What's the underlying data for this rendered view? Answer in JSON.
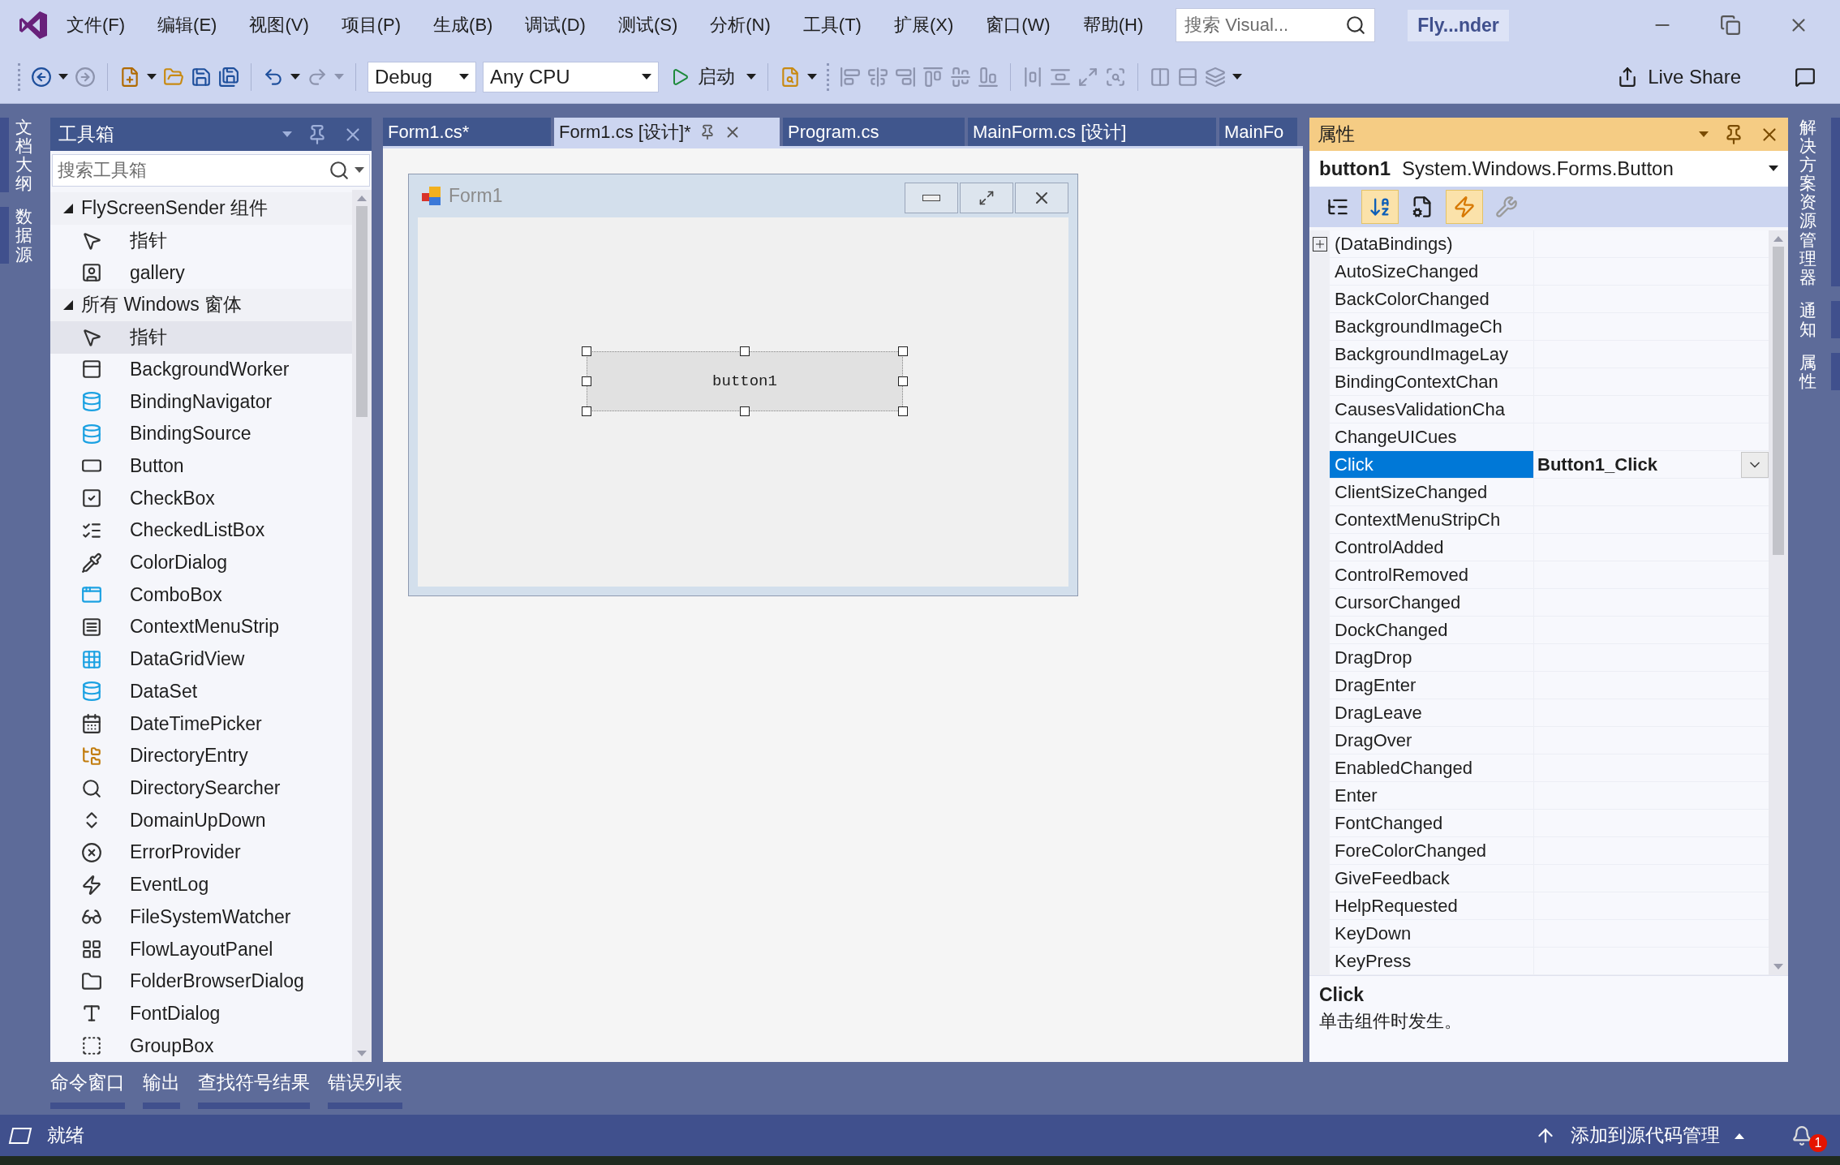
{
  "menu_bar": {
    "items": [
      "文件(F)",
      "编辑(E)",
      "视图(V)",
      "项目(P)",
      "生成(B)",
      "调试(D)",
      "测试(S)",
      "分析(N)",
      "工具(T)",
      "扩展(X)",
      "窗口(W)",
      "帮助(H)"
    ],
    "search": {
      "placeholder": "搜索 Visual..."
    },
    "title": "Fly...nder"
  },
  "toolbar": {
    "configuration": "Debug",
    "platform": "Any CPU",
    "start_label": "启动",
    "live_share": "Live Share"
  },
  "left_side_tabs": [
    "文档大纲",
    "数据源"
  ],
  "toolbox": {
    "title": "工具箱",
    "search": {
      "placeholder": "搜索工具箱"
    },
    "groups": [
      {
        "label": "FlyScreenSender 组件",
        "expanded": true,
        "children": [
          {
            "label": "指针",
            "selected": false
          },
          {
            "label": "gallery",
            "selected": false
          }
        ]
      },
      {
        "label": "所有 Windows 窗体",
        "expanded": true,
        "children": [
          {
            "label": "指针",
            "selected": true
          },
          {
            "label": "BackgroundWorker",
            "selected": false
          },
          {
            "label": "BindingNavigator",
            "selected": false
          },
          {
            "label": "BindingSource",
            "selected": false
          },
          {
            "label": "Button",
            "selected": false
          },
          {
            "label": "CheckBox",
            "selected": false
          },
          {
            "label": "CheckedListBox",
            "selected": false
          },
          {
            "label": "ColorDialog",
            "selected": false
          },
          {
            "label": "ComboBox",
            "selected": false
          },
          {
            "label": "ContextMenuStrip",
            "selected": false
          },
          {
            "label": "DataGridView",
            "selected": false
          },
          {
            "label": "DataSet",
            "selected": false
          },
          {
            "label": "DateTimePicker",
            "selected": false
          },
          {
            "label": "DirectoryEntry",
            "selected": false
          },
          {
            "label": "DirectorySearcher",
            "selected": false
          },
          {
            "label": "DomainUpDown",
            "selected": false
          },
          {
            "label": "ErrorProvider",
            "selected": false
          },
          {
            "label": "EventLog",
            "selected": false
          },
          {
            "label": "FileSystemWatcher",
            "selected": false
          },
          {
            "label": "FlowLayoutPanel",
            "selected": false
          },
          {
            "label": "FolderBrowserDialog",
            "selected": false
          },
          {
            "label": "FontDialog",
            "selected": false
          },
          {
            "label": "GroupBox",
            "selected": false
          }
        ]
      }
    ]
  },
  "document_tabs": [
    {
      "label": "Form1.cs*",
      "selected": false
    },
    {
      "label": "Form1.cs [设计]*",
      "selected": true
    },
    {
      "label": "Program.cs",
      "selected": false
    },
    {
      "label": "MainForm.cs [设计]",
      "selected": false
    },
    {
      "label": "MainFo",
      "selected": false
    }
  ],
  "designer": {
    "form_title": "Form1",
    "button_label": "button1"
  },
  "properties": {
    "title": "属性",
    "object_name": "button1",
    "object_type": "System.Windows.Forms.Button",
    "view_buttons": [
      {
        "kind": "categorized",
        "selected": false
      },
      {
        "kind": "alphabetical",
        "selected": true
      },
      {
        "kind": "properties",
        "selected": false
      },
      {
        "kind": "events",
        "selected": true
      },
      {
        "kind": "property_pages",
        "selected": false
      }
    ],
    "rows": [
      {
        "name": "(DataBindings)",
        "kind": "group",
        "selected": false
      },
      {
        "name": "AutoSizeChanged",
        "kind": "event",
        "selected": false
      },
      {
        "name": "BackColorChanged",
        "kind": "event",
        "selected": false
      },
      {
        "name": "BackgroundImageCh",
        "kind": "event",
        "selected": false
      },
      {
        "name": "BackgroundImageLay",
        "kind": "event",
        "selected": false
      },
      {
        "name": "BindingContextChan",
        "kind": "event",
        "selected": false
      },
      {
        "name": "CausesValidationCha",
        "kind": "event",
        "selected": false
      },
      {
        "name": "ChangeUICues",
        "kind": "event",
        "selected": false
      },
      {
        "name": "Click",
        "kind": "event",
        "value": "Button1_Click",
        "selected": true
      },
      {
        "name": "ClientSizeChanged",
        "kind": "event",
        "selected": false
      },
      {
        "name": "ContextMenuStripCh",
        "kind": "event",
        "selected": false
      },
      {
        "name": "ControlAdded",
        "kind": "event",
        "selected": false
      },
      {
        "name": "ControlRemoved",
        "kind": "event",
        "selected": false
      },
      {
        "name": "CursorChanged",
        "kind": "event",
        "selected": false
      },
      {
        "name": "DockChanged",
        "kind": "event",
        "selected": false
      },
      {
        "name": "DragDrop",
        "kind": "event",
        "selected": false
      },
      {
        "name": "DragEnter",
        "kind": "event",
        "selected": false
      },
      {
        "name": "DragLeave",
        "kind": "event",
        "selected": false
      },
      {
        "name": "DragOver",
        "kind": "event",
        "selected": false
      },
      {
        "name": "EnabledChanged",
        "kind": "event",
        "selected": false
      },
      {
        "name": "Enter",
        "kind": "event",
        "selected": false
      },
      {
        "name": "FontChanged",
        "kind": "event",
        "selected": false
      },
      {
        "name": "ForeColorChanged",
        "kind": "event",
        "selected": false
      },
      {
        "name": "GiveFeedback",
        "kind": "event",
        "selected": false
      },
      {
        "name": "HelpRequested",
        "kind": "event",
        "selected": false
      },
      {
        "name": "KeyDown",
        "kind": "event",
        "selected": false
      },
      {
        "name": "KeyPress",
        "kind": "event",
        "selected": false
      }
    ],
    "description": {
      "title": "Click",
      "text": "单击组件时发生。"
    }
  },
  "right_side_tabs": [
    "解决方案资源管理器",
    "通知",
    "属性"
  ],
  "bottom_tabs": [
    "命令窗口",
    "输出",
    "查找符号结果",
    "错误列表"
  ],
  "status_bar": {
    "text": "就绪",
    "source_control": "添加到源代码管理",
    "notification_count": "1"
  }
}
